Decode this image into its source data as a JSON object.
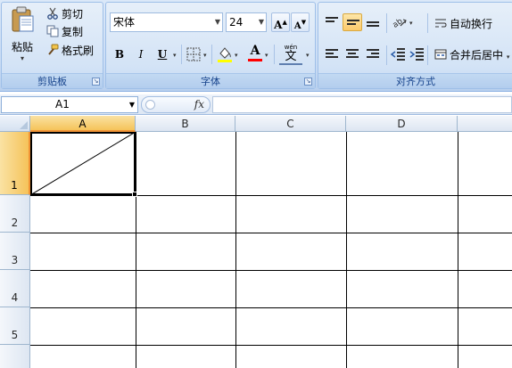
{
  "ribbon": {
    "clipboard": {
      "paste_label": "粘贴",
      "cut_label": "剪切",
      "copy_label": "复制",
      "format_painter_label": "格式刷",
      "group_label": "剪贴板"
    },
    "font": {
      "font_name": "宋体",
      "font_size": "24",
      "grow_label": "A",
      "shrink_label": "A",
      "bold_label": "B",
      "italic_label": "I",
      "underline_label": "U",
      "phonetic_label": "文",
      "group_label": "字体",
      "fill_color": "#ffff00",
      "font_color": "#ff0000"
    },
    "alignment": {
      "wrap_text_label": "自动换行",
      "merge_center_label": "合并后居中",
      "group_label": "对齐方式"
    }
  },
  "formula_bar": {
    "name_box": "A1",
    "fx_label": "fx",
    "formula": ""
  },
  "grid": {
    "columns": [
      "A",
      "B",
      "C",
      "D"
    ],
    "rows": [
      "1",
      "2",
      "3",
      "4",
      "5"
    ],
    "selected_column": "A",
    "selected_row": "1",
    "selected_cell": "A1"
  }
}
